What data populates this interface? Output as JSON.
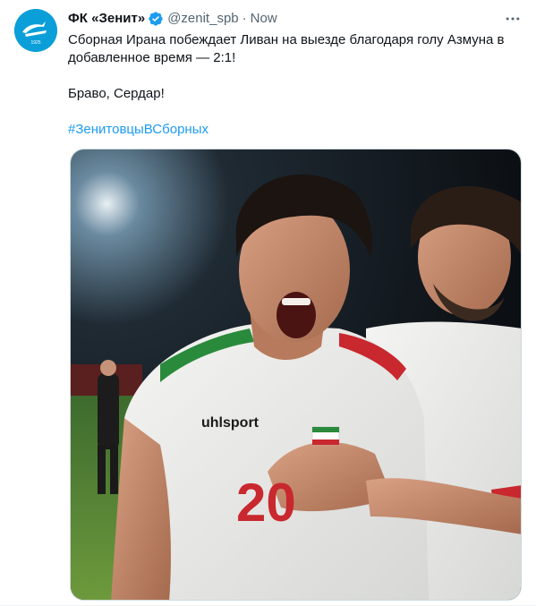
{
  "tweet": {
    "author": {
      "display_name": "ФК «Зенит»",
      "handle": "@zenit_spb",
      "verified": true,
      "avatar_icon": "zenit-logo-icon"
    },
    "separator": "·",
    "timestamp": "Now",
    "text_lines": [
      "Сборная Ирана побеждает Ливан на выезде благодаря голу Азмуна в",
      "добавленное время — 2:1!"
    ],
    "second_paragraph": "Браво, Сердар!",
    "hashtag": "#ЗенитовцыВСборных",
    "media": {
      "kind": "photo",
      "shirt_brand": "uhlsport",
      "shirt_number": "20"
    },
    "more_icon": "more-options-icon"
  },
  "colors": {
    "text": "#0f1419",
    "secondary": "#536471",
    "accent": "#1d9bf0",
    "avatar_bg": "#0a9fd8"
  }
}
